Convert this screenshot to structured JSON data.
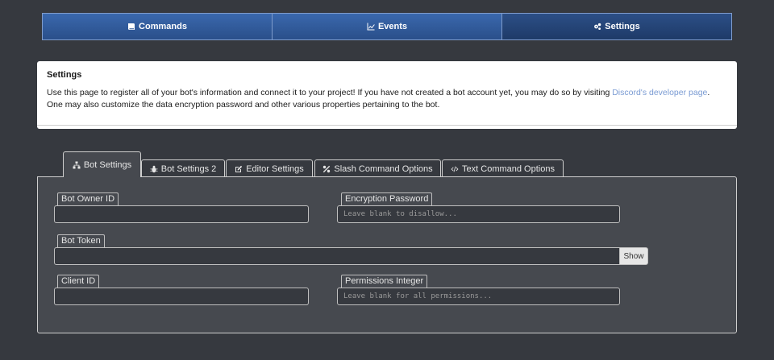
{
  "nav": {
    "items": [
      {
        "label": "Commands",
        "icon": "book-icon"
      },
      {
        "label": "Events",
        "icon": "line-chart-icon"
      },
      {
        "label": "Settings",
        "icon": "gears-icon"
      }
    ],
    "active": "Settings"
  },
  "info": {
    "title": "Settings",
    "desc_before": "Use this page to register all of your bot's information and connect it to your project! If you have not created a bot account yet, you may do so by visiting ",
    "link_text": "Discord's developer page",
    "desc_after": ". One may also customize the data encryption password and other various properties pertaining to the bot."
  },
  "tabs": [
    {
      "label": "Bot Settings",
      "icon": "sitemap-icon"
    },
    {
      "label": "Bot Settings 2",
      "icon": "bug-icon"
    },
    {
      "label": "Editor Settings",
      "icon": "edit-icon"
    },
    {
      "label": "Slash Command Options",
      "icon": "percent-icon"
    },
    {
      "label": "Text Command Options",
      "icon": "code-icon"
    }
  ],
  "fields": {
    "owner_id": {
      "label": "Bot Owner ID",
      "value": "",
      "placeholder": ""
    },
    "encryption": {
      "label": "Encryption Password",
      "value": "",
      "placeholder": "Leave blank to disallow..."
    },
    "token": {
      "label": "Bot Token",
      "value": "",
      "placeholder": "",
      "show_label": "Show"
    },
    "client_id": {
      "label": "Client ID",
      "value": "",
      "placeholder": ""
    },
    "permissions": {
      "label": "Permissions Integer",
      "value": "",
      "placeholder": "Leave blank for all permissions..."
    }
  },
  "colors": {
    "background": "#36393f",
    "panel": "#46494f",
    "nav_blue": "#2b4f88",
    "link": "#7a9bd3"
  }
}
